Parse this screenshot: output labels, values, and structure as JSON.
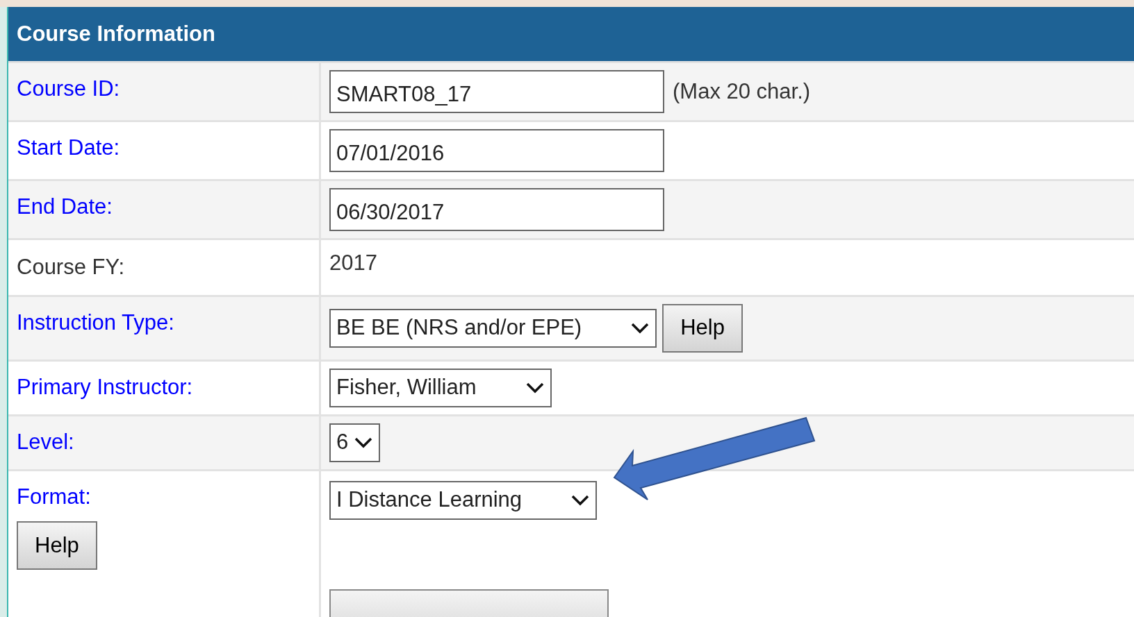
{
  "panel": {
    "title": "Course Information"
  },
  "rows": [
    {
      "label": "Course ID:",
      "link": true,
      "kind": "text",
      "value": "SMART08_17",
      "note": "(Max 20 char.)"
    },
    {
      "label": "Start Date:",
      "link": true,
      "kind": "text",
      "value": "07/01/2016"
    },
    {
      "label": "End Date:",
      "link": true,
      "kind": "text",
      "value": "06/30/2017"
    },
    {
      "label": "Course FY:",
      "link": false,
      "kind": "static",
      "value": "2017"
    },
    {
      "label": "Instruction Type:",
      "link": true,
      "kind": "select",
      "value": "BE BE (NRS and/or EPE)",
      "help": "Help"
    },
    {
      "label": "Primary Instructor:",
      "link": true,
      "kind": "select",
      "value": "Fisher, William"
    },
    {
      "label": "Level:",
      "link": true,
      "kind": "select",
      "value": "6"
    },
    {
      "label": "Format:",
      "link": true,
      "kind": "select",
      "value": "I Distance Learning",
      "label_help": "Help",
      "extra": true
    }
  ]
}
